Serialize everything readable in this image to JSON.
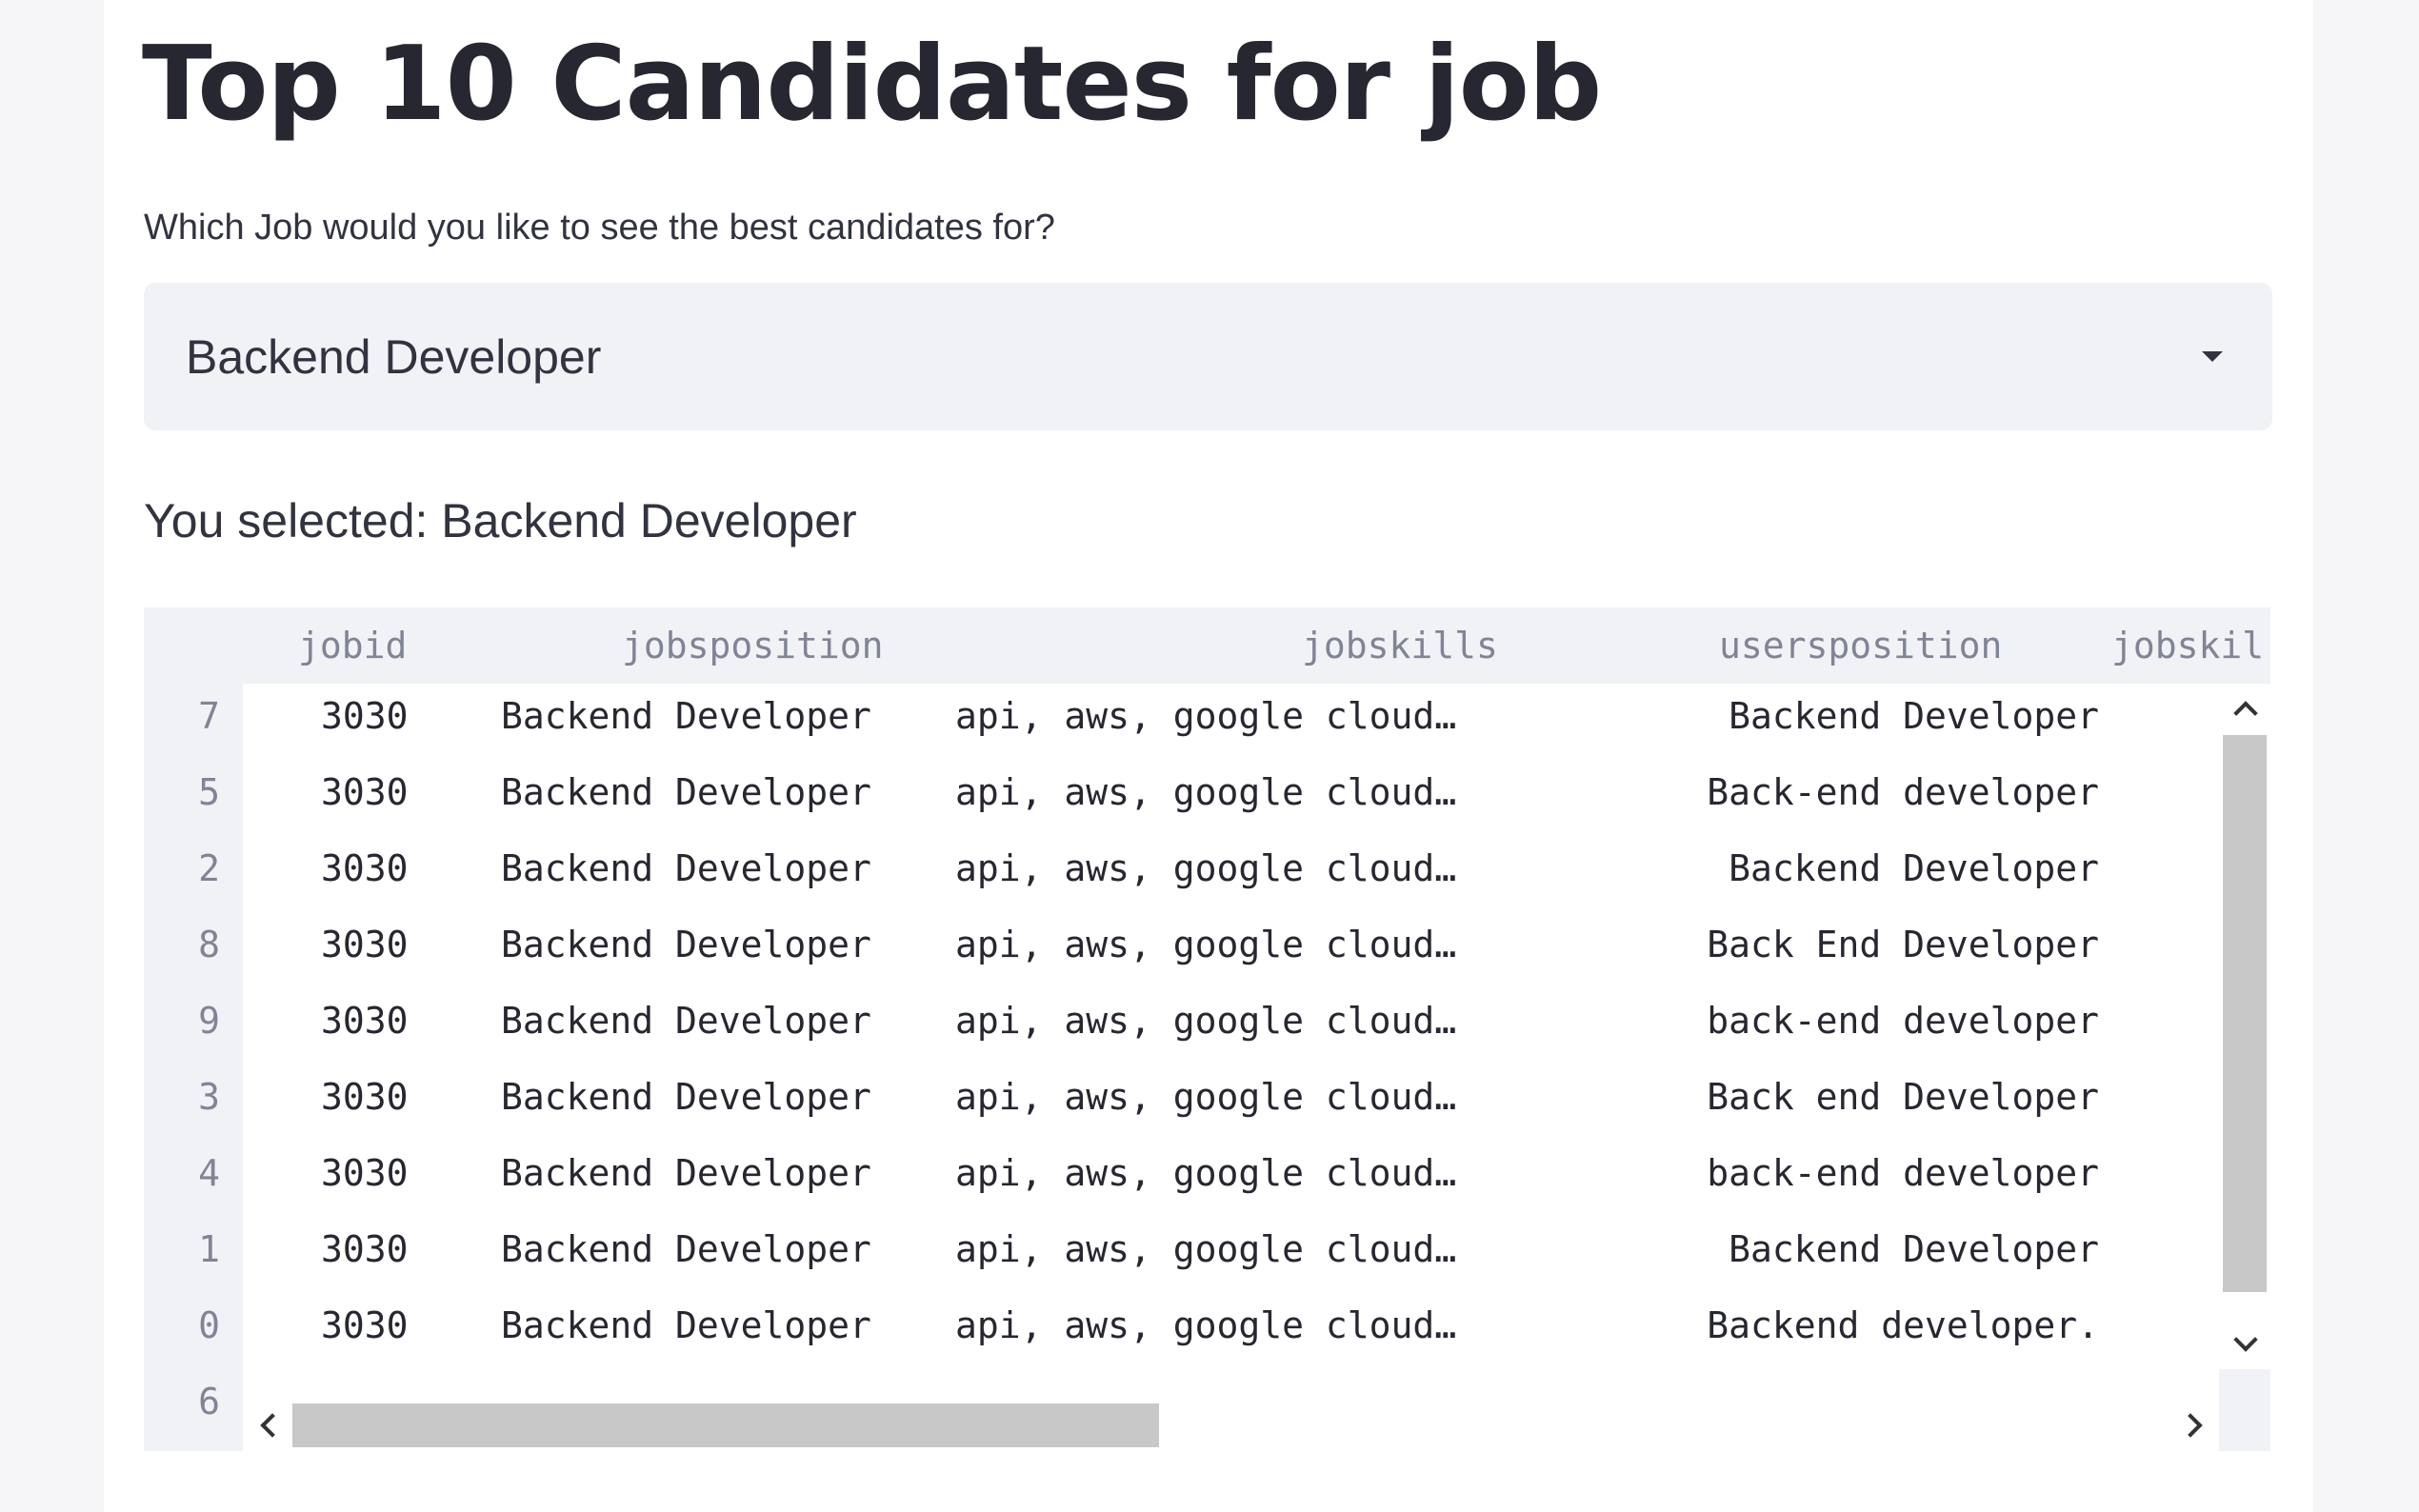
{
  "page": {
    "title": "Top 10 Candidates for job",
    "question": "Which Job would you like to see the best candidates for?",
    "select": {
      "value": "Backend Developer"
    },
    "selected_text": "You selected: Backend Developer"
  },
  "table": {
    "columns": [
      "jobid",
      "jobsposition",
      "jobskills",
      "usersposition",
      "jobskil"
    ],
    "rows": [
      {
        "index": "7",
        "jobid": "3030",
        "jobsposition": "Backend Developer",
        "jobskills": "api, aws, google cloud…",
        "usersposition": "Backend Developer"
      },
      {
        "index": "5",
        "jobid": "3030",
        "jobsposition": "Backend Developer",
        "jobskills": "api, aws, google cloud…",
        "usersposition": "Back-end developer"
      },
      {
        "index": "2",
        "jobid": "3030",
        "jobsposition": "Backend Developer",
        "jobskills": "api, aws, google cloud…",
        "usersposition": "Backend Developer"
      },
      {
        "index": "8",
        "jobid": "3030",
        "jobsposition": "Backend Developer",
        "jobskills": "api, aws, google cloud…",
        "usersposition": "Back End Developer"
      },
      {
        "index": "9",
        "jobid": "3030",
        "jobsposition": "Backend Developer",
        "jobskills": "api, aws, google cloud…",
        "usersposition": "back-end developer"
      },
      {
        "index": "3",
        "jobid": "3030",
        "jobsposition": "Backend Developer",
        "jobskills": "api, aws, google cloud…",
        "usersposition": "Back end Developer"
      },
      {
        "index": "4",
        "jobid": "3030",
        "jobsposition": "Backend Developer",
        "jobskills": "api, aws, google cloud…",
        "usersposition": "back-end developer"
      },
      {
        "index": "1",
        "jobid": "3030",
        "jobsposition": "Backend Developer",
        "jobskills": "api, aws, google cloud…",
        "usersposition": "Backend Developer"
      },
      {
        "index": "0",
        "jobid": "3030",
        "jobsposition": "Backend Developer",
        "jobskills": "api, aws, google cloud…",
        "usersposition": "Backend developer."
      },
      {
        "index": "6",
        "jobid": "",
        "jobsposition": "",
        "jobskills": "",
        "usersposition": ""
      }
    ]
  },
  "icons": {
    "select_caret": "caret-down-icon",
    "scroll_up": "chevron-up-icon",
    "scroll_down": "chevron-down-icon",
    "scroll_left": "chevron-left-icon",
    "scroll_right": "chevron-right-icon"
  },
  "colors": {
    "title": "#262730",
    "text": "#31333f",
    "muted": "#808495",
    "select_bg": "#f0f2f6"
  }
}
